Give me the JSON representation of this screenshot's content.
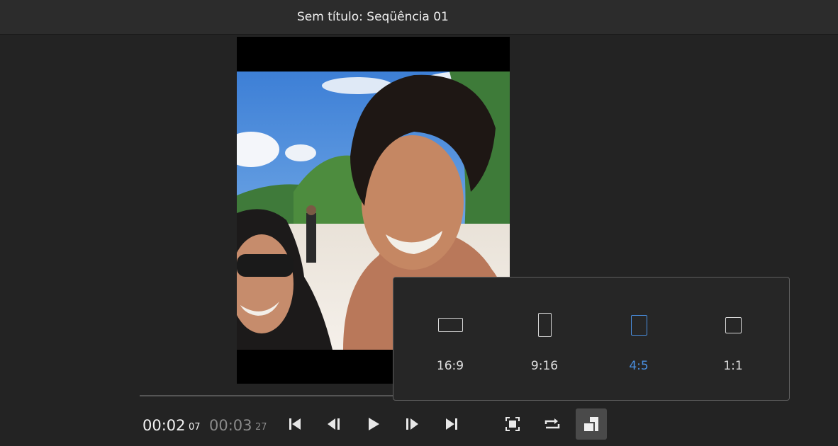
{
  "window": {
    "title": "Sem título: Seqüência 01"
  },
  "timecode": {
    "current": "00:02",
    "current_frames": "07",
    "duration": "00:03",
    "duration_frames": "27"
  },
  "controls": [
    {
      "name": "go-to-in-point",
      "icon": "skip-to-start-icon"
    },
    {
      "name": "step-back",
      "icon": "step-back-icon"
    },
    {
      "name": "play",
      "icon": "play-icon"
    },
    {
      "name": "step-forward",
      "icon": "step-forward-icon"
    },
    {
      "name": "go-to-out-point",
      "icon": "skip-to-end-icon"
    },
    {
      "name": "fit-frame",
      "icon": "fit-frame-icon"
    },
    {
      "name": "loop",
      "icon": "loop-icon"
    },
    {
      "name": "aspect-ratio",
      "icon": "aspect-ratio-icon"
    }
  ],
  "aspect_popup": {
    "options": [
      {
        "label": "16:9",
        "selected": false
      },
      {
        "label": "9:16",
        "selected": false
      },
      {
        "label": "4:5",
        "selected": true
      },
      {
        "label": "1:1",
        "selected": false
      }
    ]
  },
  "colors": {
    "accent": "#4a90e2",
    "background": "#232323",
    "panel": "#262626"
  }
}
